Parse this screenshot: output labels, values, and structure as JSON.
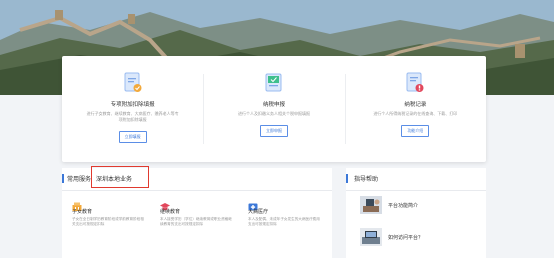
{
  "cards": [
    {
      "icon": "tax-deduction-icon",
      "title": "专项附加扣除填报",
      "desc": "进行子女教育、继续教育、大病医疗、赡养老人等专项附加扣除填报",
      "button": "立即填报"
    },
    {
      "icon": "tax-declaration-icon",
      "title": "纳税申报",
      "desc": "进行个人及扣缴义务人相关个税申报填报",
      "button": "立即申报"
    },
    {
      "icon": "tax-record-icon",
      "title": "纳税记录",
      "desc": "进行个人所得纳税记录的在线查询、下载、打印",
      "button": "功能介绍"
    }
  ],
  "services": {
    "tab_common": "常用服务",
    "tab_local": "深圳本地业务",
    "items": [
      {
        "icon": "children-education-icon",
        "title": "子女教育",
        "desc": "子女在全日制学历教育阶段或学前教育阶段相关支出可按规定扣除",
        "color": "#f2a93b"
      },
      {
        "icon": "continuing-education-icon",
        "title": "继续教育",
        "desc": "本人接受学历（学位）继续教育或职业资格继续教育的支出可按规定扣除",
        "color": "#e2475c"
      },
      {
        "icon": "medical-icon",
        "title": "大病医疗",
        "desc": "本人及配偶、未成年子女发生的大病医疗费用支出可按规定扣除",
        "color": "#3c78d8"
      }
    ]
  },
  "help": {
    "title": "指导帮助",
    "items": [
      {
        "label": "平台功能简介"
      },
      {
        "label": "如何访问平台？"
      }
    ]
  }
}
